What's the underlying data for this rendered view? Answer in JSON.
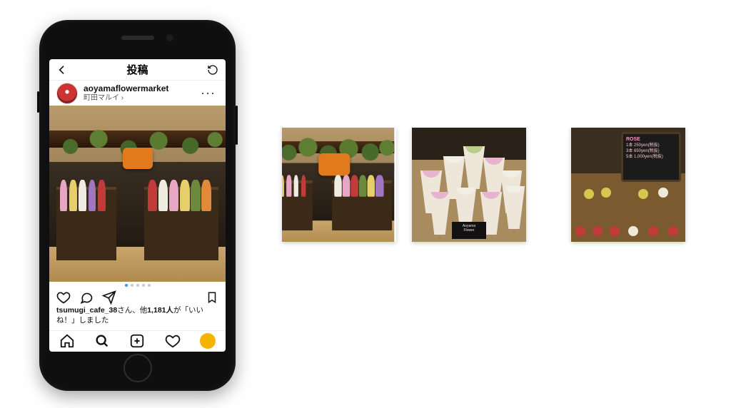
{
  "header": {
    "title": "投稿"
  },
  "post": {
    "username": "aoyamaflowermarket",
    "location": "町田マルイ ›",
    "caption_user": "tsumugi_cafe_38",
    "caption_suffix": "さん、",
    "caption_others_prefix": "他",
    "caption_count": "1,181人",
    "caption_tail": "が「いいね！」しました",
    "carousel_count": 5,
    "carousel_active_index": 0
  },
  "chalkboard": {
    "heading": "ROSE",
    "line1": "1本 250yen(税抜)",
    "line2": "3本 650yen(税抜)",
    "line3": "5本 1,000yen(税抜)"
  },
  "icons": {
    "back": "chevron-left",
    "refresh": "refresh",
    "more": "ellipsis",
    "like": "heart",
    "comment": "speech-bubble",
    "share": "paper-plane",
    "bookmark": "bookmark",
    "home": "home",
    "search": "magnifier",
    "add": "plus-square",
    "activity": "heart",
    "profile": "profile-dot"
  },
  "colors": {
    "accent": "#3897f0",
    "profile_dot": "#f5b400"
  }
}
